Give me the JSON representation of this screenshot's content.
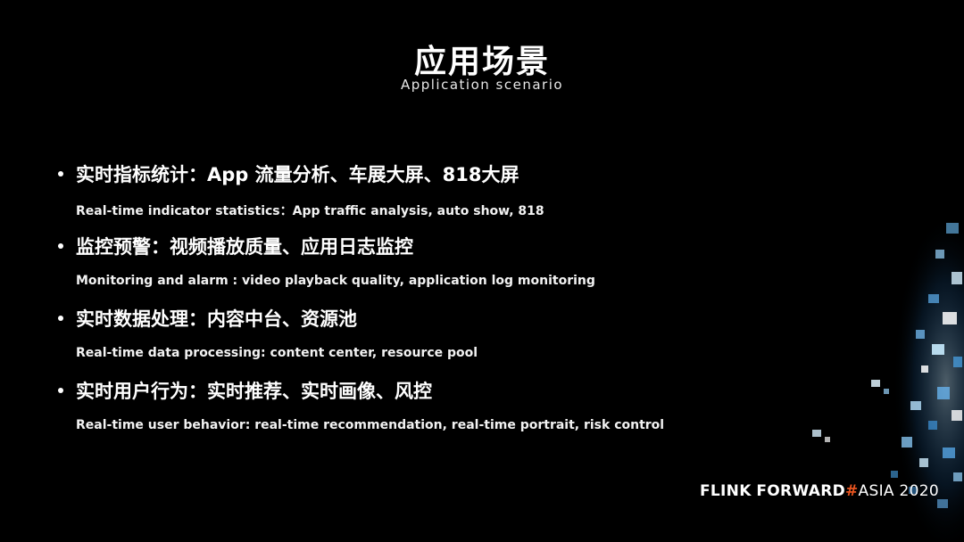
{
  "title": "应用场景",
  "subtitle": "Application scenario",
  "items": [
    {
      "zh": "实时指标统计：App 流量分析、车展大屏、818大屏",
      "en": "Real-time indicator statistics：App traffic analysis, auto show, 818"
    },
    {
      "zh": "监控预警：视频播放质量、应用日志监控",
      "en": "Monitoring and alarm : video playback quality, application log monitoring"
    },
    {
      "zh": "实时数据处理：内容中台、资源池",
      "en": "Real-time data processing: content center, resource pool"
    },
    {
      "zh": "实时用户行为：实时推荐、实时画像、风控",
      "en": "Real-time user behavior: real-time recommendation, real-time portrait, risk control"
    }
  ],
  "brand": {
    "part1": "FLINK",
    "part2": "FORWARD",
    "hash": "#",
    "part3": "ASIA 2020"
  },
  "colors": {
    "background": "#000000",
    "text": "#ffffff",
    "brand_accent": "#e8541f",
    "glow": "#4fb3ff"
  }
}
